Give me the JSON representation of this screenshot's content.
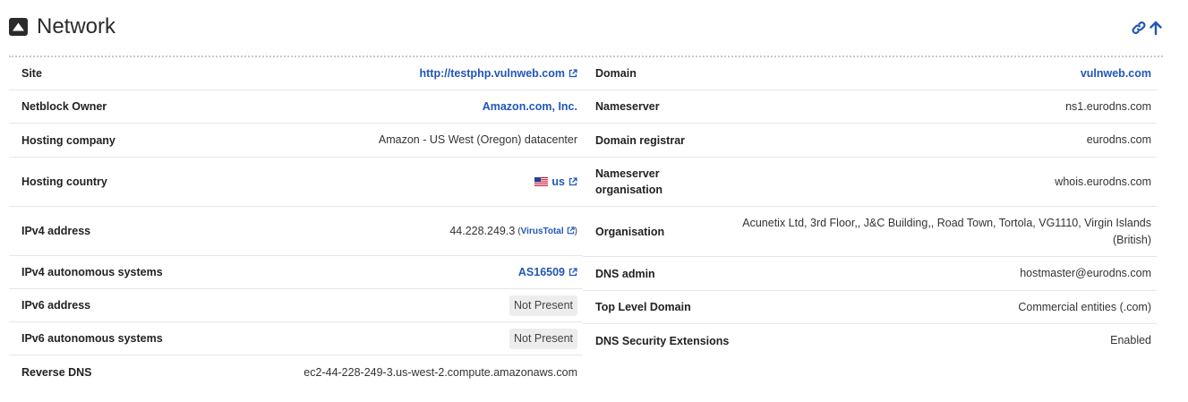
{
  "section": {
    "title": "Network",
    "actions": [
      {
        "icon": "link-icon",
        "name": "permalink"
      },
      {
        "icon": "arrow-up-icon",
        "name": "back-to-top"
      }
    ]
  },
  "colors": {
    "link": "#2156b8",
    "text": "#333333",
    "badge_bg": "#ededed"
  },
  "left": {
    "site": {
      "label": "Site",
      "value": "http://testphp.vulnweb.com"
    },
    "netblock_owner": {
      "label": "Netblock Owner",
      "value": "Amazon.com, Inc."
    },
    "hosting_company": {
      "label": "Hosting company",
      "value": "Amazon - US West (Oregon) datacenter"
    },
    "hosting_country": {
      "label": "Hosting country",
      "value": "us",
      "flag": "us-flag-icon"
    },
    "ipv4_address": {
      "label": "IPv4 address",
      "value": "44.228.249.3",
      "open": "(",
      "vt": "VirusTotal",
      "close": ")"
    },
    "ipv4_as": {
      "label": "IPv4 autonomous systems",
      "value": "AS16509"
    },
    "ipv6_address": {
      "label": "IPv6 address",
      "value": "Not Present"
    },
    "ipv6_as": {
      "label": "IPv6 autonomous systems",
      "value": "Not Present"
    },
    "reverse_dns": {
      "label": "Reverse DNS",
      "value": "ec2-44-228-249-3.us-west-2.compute.amazonaws.com"
    }
  },
  "right": {
    "domain": {
      "label": "Domain",
      "value": "vulnweb.com"
    },
    "nameserver": {
      "label": "Nameserver",
      "value": "ns1.eurodns.com"
    },
    "domain_registrar": {
      "label": "Domain registrar",
      "value": "eurodns.com"
    },
    "nameserver_org": {
      "label": "Nameserver organisation",
      "value": "whois.eurodns.com"
    },
    "organisation": {
      "label": "Organisation",
      "value": "Acunetix Ltd, 3rd Floor,, J&C Building,, Road Town, Tortola, VG1110, Virgin Islands (British)"
    },
    "dns_admin": {
      "label": "DNS admin",
      "value": "hostmaster@eurodns.com"
    },
    "tld": {
      "label": "Top Level Domain",
      "value": "Commercial entities (.com)"
    },
    "dnssec": {
      "label": "DNS Security Extensions",
      "value": "Enabled"
    }
  }
}
